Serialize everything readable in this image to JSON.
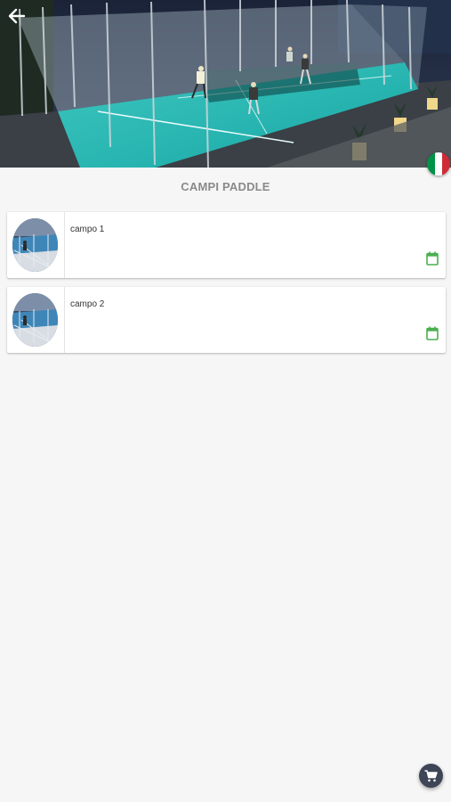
{
  "header": {
    "back_icon": "arrow-left-icon",
    "hero_image": "paddle-court-night-photo",
    "language_flag": {
      "icon": "italy-flag-icon",
      "colors": [
        "#009246",
        "#ffffff",
        "#ce2b37"
      ]
    }
  },
  "main": {
    "title": "CAMPI PADDLE",
    "courts": [
      {
        "label": "campo 1",
        "thumbnail": "court-thumbnail",
        "action_icon": "calendar-icon"
      },
      {
        "label": "campo 2",
        "thumbnail": "court-thumbnail",
        "action_icon": "calendar-icon"
      }
    ]
  },
  "cart": {
    "icon": "cart-icon"
  },
  "colors": {
    "background": "#f6f6f6",
    "title": "#8a8a8a",
    "calendar_accent": "#4caf50",
    "cart_button": "#3d4556"
  }
}
